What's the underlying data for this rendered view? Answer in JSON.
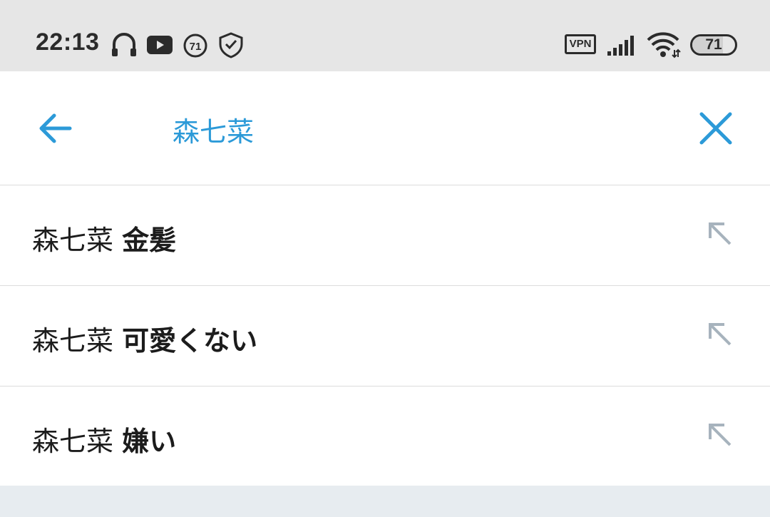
{
  "status_bar": {
    "time": "22:13",
    "notification_icons": [
      "headphones-icon",
      "youtube-icon",
      "badge-71-icon",
      "shield-check-icon"
    ],
    "notification_badge": "71",
    "vpn_label": "VPN",
    "signal_icon": "signal-bars-icon",
    "wifi_icon": "wifi-icon",
    "battery_level": "71",
    "battery_fraction": 0.71
  },
  "header": {
    "back_icon": "arrow-left-icon",
    "query": "森七菜",
    "clear_icon": "close-icon"
  },
  "suggestions": [
    {
      "prefix": "森七菜",
      "completion": "金髪",
      "icon": "arrow-up-left-icon"
    },
    {
      "prefix": "森七菜",
      "completion": "可愛くない",
      "icon": "arrow-up-left-icon"
    },
    {
      "prefix": "森七菜",
      "completion": "嫌い",
      "icon": "arrow-up-left-icon"
    }
  ],
  "colors": {
    "accent": "#2c9ad8",
    "status_bar_bg": "#e6e6e6",
    "text": "#1c1c1c",
    "fill_arrow": "#a7b3bd",
    "divider": "#dcdcdc",
    "background": "#e7ecf0"
  }
}
